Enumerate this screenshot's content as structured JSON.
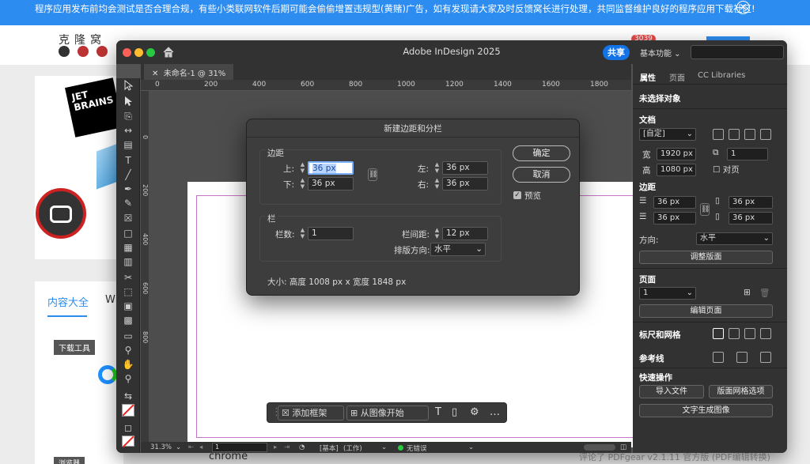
{
  "website": {
    "banner_text": "程序应用发布前均会测试是否合理合规，有些小类联网软件后期可能会偷偷增置违规型(黄赌)广告，如有发现请大家及时反馈窝长进行处理，共同监督维护良好的程序应用下载社区!",
    "logo_text": "克隆窝",
    "badge_count": "3039",
    "jetbrains_text": "JET BRAINS",
    "tab_active": "内容大全",
    "tab_other": "W",
    "tag_download_tools": "下载工具",
    "tag_browser": "浏览器",
    "chrome_label": "chrome",
    "right_snippet": "评论了 PDFgear v2.1.11 官方版 (PDF编辑转换)"
  },
  "app": {
    "title": "Adobe InDesign 2025",
    "share_label": "共享",
    "workspace_label": "基本功能",
    "doc_tab": "未命名-1 @ 31%",
    "ruler_h": [
      "0",
      "200",
      "400",
      "600",
      "800",
      "1000",
      "1200",
      "1400",
      "1600",
      "1800"
    ],
    "ruler_v": [
      "0",
      "200",
      "400",
      "600",
      "800"
    ],
    "floatbar": {
      "add_frame": "添加框架",
      "from_image": "从图像开始"
    },
    "status": {
      "zoom": "31.3%",
      "page": "1",
      "master": "[基本]",
      "mode": "(工作)",
      "preflight": "无错误"
    }
  },
  "panel": {
    "tabs": [
      "属性",
      "页面",
      "CC Libraries"
    ],
    "no_selection": "未选择对象",
    "document": "文档",
    "preset": "[自定]",
    "width_label": "宽",
    "width_value": "1920 px",
    "height_label": "高",
    "height_value": "1080 px",
    "pages_value": "1",
    "facing_pages": "对页",
    "margins_label": "边距",
    "margins": [
      "36 px",
      "36 px",
      "36 px",
      "36 px"
    ],
    "orientation_label": "方向:",
    "orientation_value": "水平",
    "adjust_layout": "调整版面",
    "pages_label": "页面",
    "page_select": "1",
    "edit_page": "编辑页面",
    "rulers_grids": "标尺和网格",
    "guides": "参考线",
    "quick_actions": "快速操作",
    "import_file": "导入文件",
    "layout_grid_options": "版面网格选项",
    "text_to_image": "文字生成图像"
  },
  "dialog": {
    "title": "新建边距和分栏",
    "margins_group": "边距",
    "top_label": "上:",
    "top_value": "36 px",
    "bottom_label": "下:",
    "bottom_value": "36 px",
    "left_label": "左:",
    "left_value": "36 px",
    "right_label": "右:",
    "right_value": "36 px",
    "columns_group": "栏",
    "num_label": "栏数:",
    "num_value": "1",
    "gutter_label": "栏间距:",
    "gutter_value": "12 px",
    "direction_label": "排版方向:",
    "direction_value": "水平",
    "size_text": "大小: 高度 1008 px x 宽度 1848 px",
    "ok": "确定",
    "cancel": "取消",
    "preview": "预览"
  }
}
